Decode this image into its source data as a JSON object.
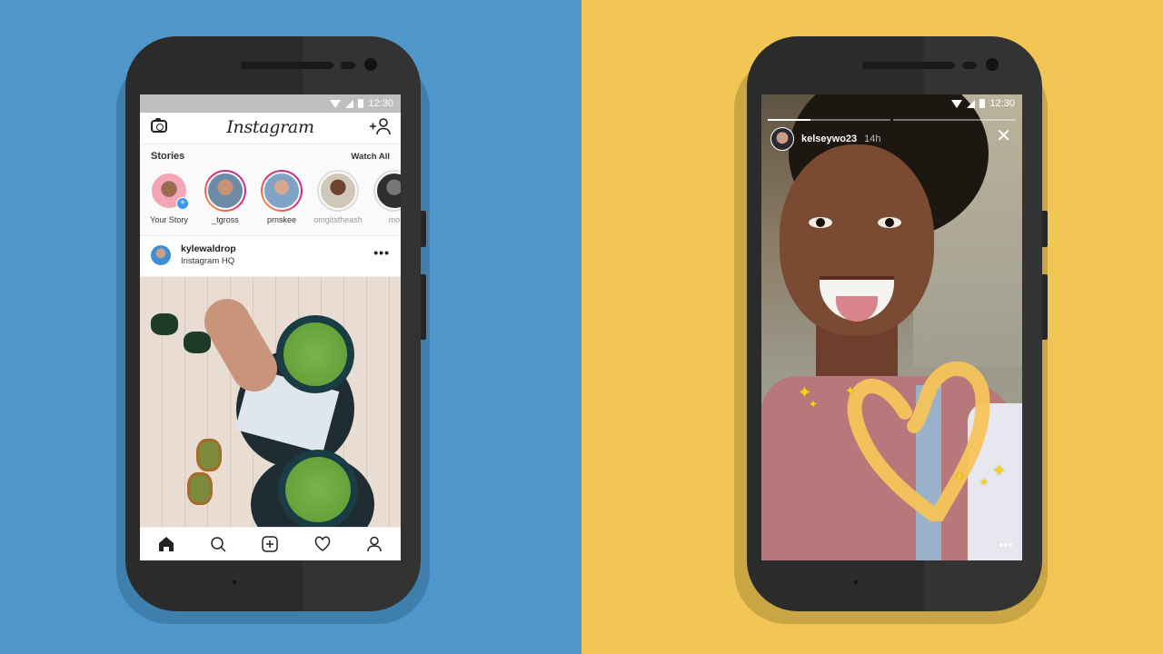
{
  "colors": {
    "left_background": "#4f97cb",
    "right_background": "#f2c654",
    "story_ring_gradient": [
      "#f9a93b",
      "#e1306c",
      "#b02ea8"
    ],
    "add_badge": "#3897f0",
    "heart_drawing": "#f5c45a"
  },
  "left_phone": {
    "status_bar": {
      "time": "12:30",
      "icons": [
        "wifi-icon",
        "signal-icon",
        "battery-icon"
      ]
    },
    "header": {
      "left_icon": "camera-icon",
      "title": "Instagram",
      "right_icon": "add-user-icon",
      "right_icon_glyph": "+👤"
    },
    "stories": {
      "title": "Stories",
      "watch_all": "Watch All",
      "items": [
        {
          "label": "Your Story",
          "state": "own",
          "badge": "+"
        },
        {
          "label": "_tgross",
          "state": "unseen"
        },
        {
          "label": "prnskee",
          "state": "unseen"
        },
        {
          "label": "omgitstheash",
          "state": "seen"
        },
        {
          "label": "mo",
          "state": "seen"
        }
      ]
    },
    "post": {
      "username": "kylewaldrop",
      "location": "Instagram HQ",
      "more": "•••"
    },
    "bottom_nav": [
      "home-icon",
      "search-icon",
      "new-post-icon",
      "activity-heart-icon",
      "profile-icon"
    ]
  },
  "right_phone": {
    "status_bar": {
      "time": "12:30",
      "icons": [
        "wifi-icon",
        "signal-icon",
        "battery-icon"
      ]
    },
    "story": {
      "username": "kelseywo23",
      "time_ago": "14h",
      "close": "✕",
      "more": "•••",
      "segments": 2,
      "current_segment_progress": 0.35,
      "sparkle_glyph": "✦"
    }
  }
}
